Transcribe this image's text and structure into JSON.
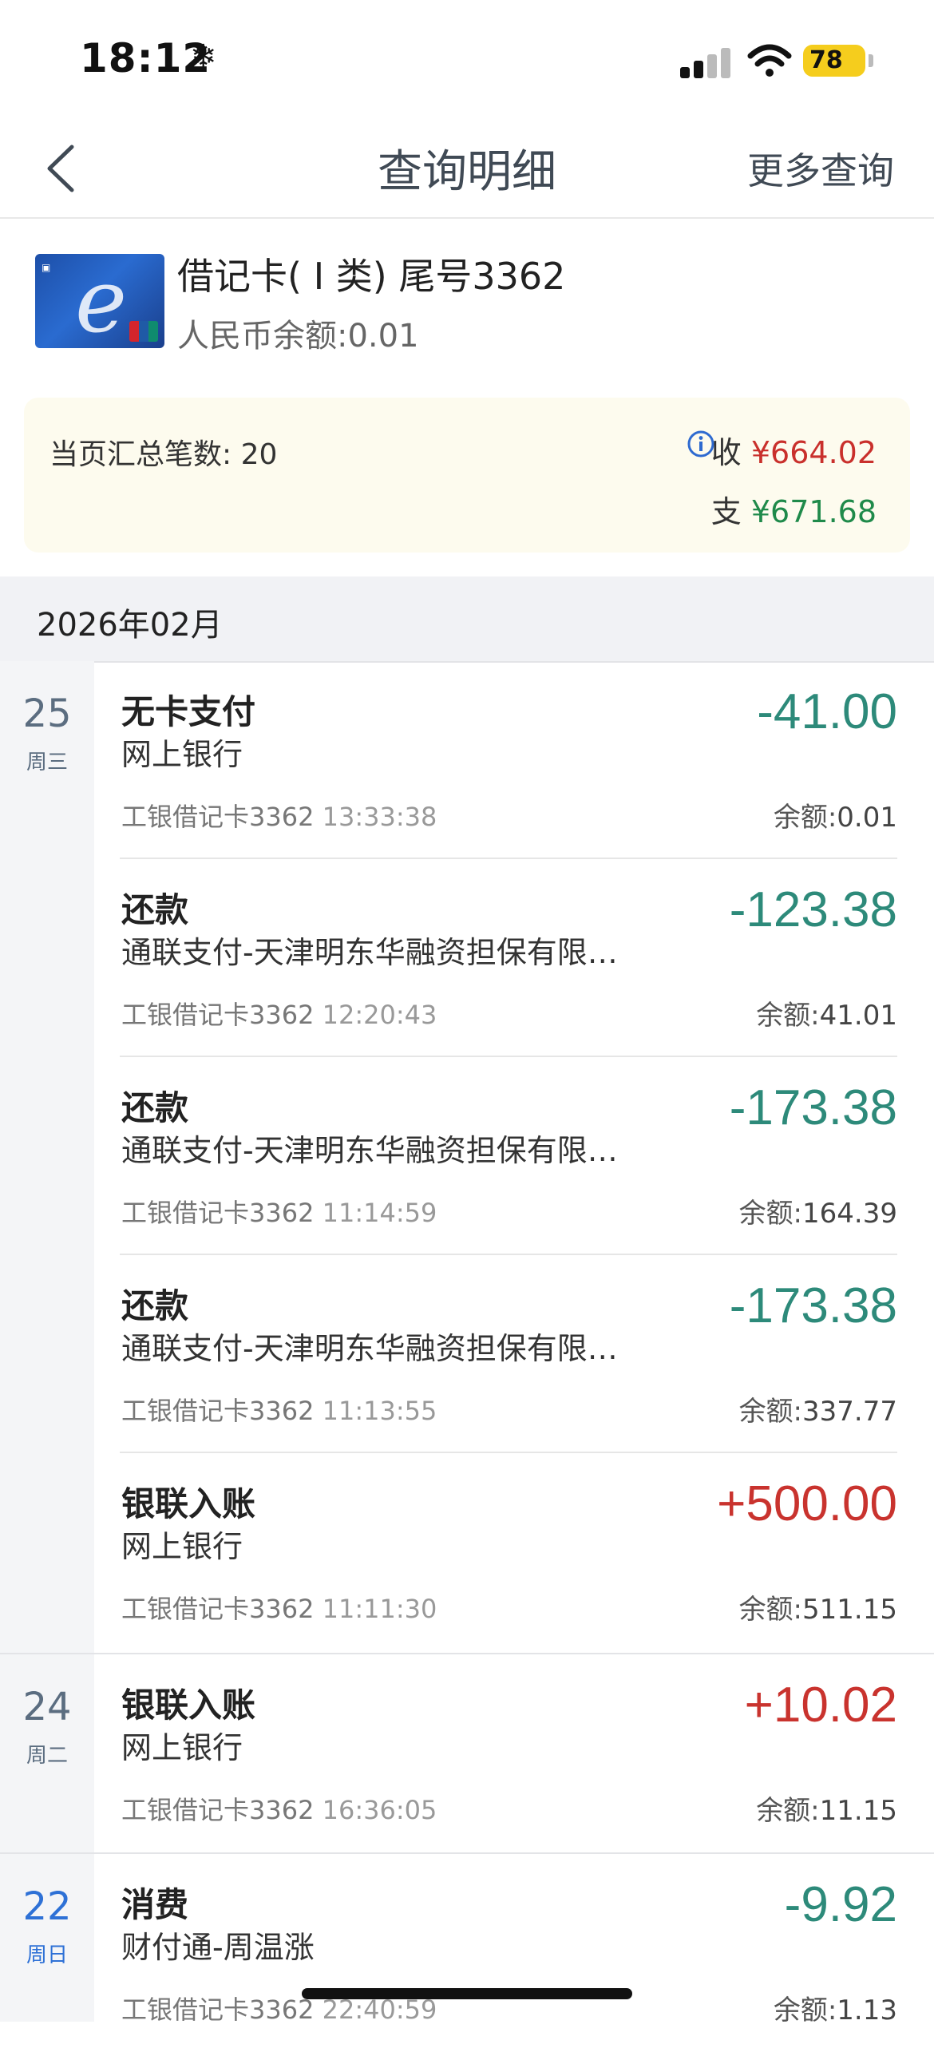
{
  "status_bar": {
    "time": "18:12",
    "battery": "78"
  },
  "nav": {
    "title": "查询明细",
    "more": "更多查询"
  },
  "card": {
    "name": "借记卡( I 类) 尾号3362",
    "balance": "人民币余额:0.01"
  },
  "summary": {
    "count_text": "当页汇总笔数: 20",
    "in_label": "收",
    "in_amount": "¥664.02",
    "out_label": "支",
    "out_amount": "¥671.68"
  },
  "month": "2026年02月",
  "balance_label": "余额:",
  "days": [
    {
      "day": "25",
      "weekday": "周三",
      "transactions": [
        {
          "title": "无卡支付",
          "subtitle": "网上银行",
          "card": "工银借记卡3362",
          "time": "13:33:38",
          "amount": "-41.00",
          "balance": "0.01"
        },
        {
          "title": "还款",
          "subtitle": "通联支付-天津明东华融资担保有限…",
          "card": "工银借记卡3362",
          "time": "12:20:43",
          "amount": "-123.38",
          "balance": "41.01"
        },
        {
          "title": "还款",
          "subtitle": "通联支付-天津明东华融资担保有限…",
          "card": "工银借记卡3362",
          "time": "11:14:59",
          "amount": "-173.38",
          "balance": "164.39"
        },
        {
          "title": "还款",
          "subtitle": "通联支付-天津明东华融资担保有限…",
          "card": "工银借记卡3362",
          "time": "11:13:55",
          "amount": "-173.38",
          "balance": "337.77"
        },
        {
          "title": "银联入账",
          "subtitle": "网上银行",
          "card": "工银借记卡3362",
          "time": "11:11:30",
          "amount": "+500.00",
          "balance": "511.15"
        }
      ]
    },
    {
      "day": "24",
      "weekday": "周二",
      "transactions": [
        {
          "title": "银联入账",
          "subtitle": "网上银行",
          "card": "工银借记卡3362",
          "time": "16:36:05",
          "amount": "+10.02",
          "balance": "11.15"
        }
      ]
    },
    {
      "day": "22",
      "weekday": "周日",
      "transactions": [
        {
          "title": "消费",
          "subtitle": "财付通-周温涨",
          "card": "工银借记卡3362",
          "time": "22:40:59",
          "amount": "-9.92",
          "balance": "1.13"
        }
      ]
    }
  ],
  "colors": {
    "income": "#c9332e",
    "expense": "#2d8a7a",
    "summary_bg": "#fdfbee",
    "battery": "#f5cd1d"
  }
}
